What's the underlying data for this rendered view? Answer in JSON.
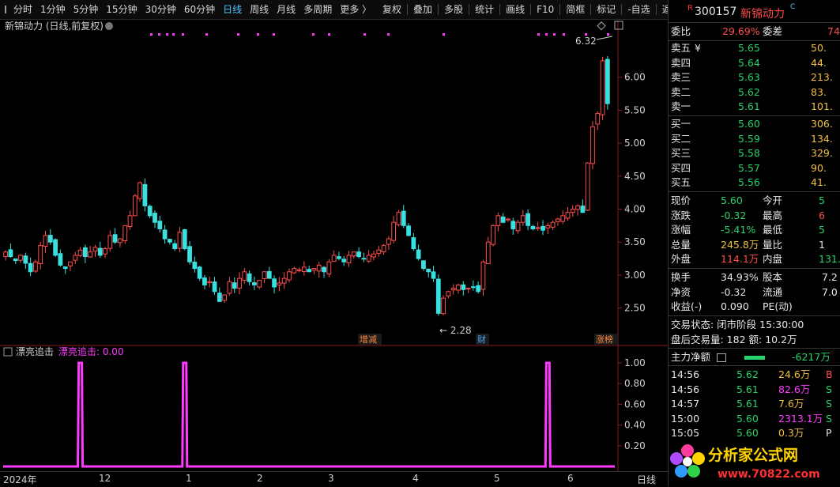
{
  "toolbar": {
    "periods": [
      "分时",
      "1分钟",
      "5分钟",
      "15分钟",
      "30分钟",
      "60分钟",
      "日线",
      "周线",
      "月线",
      "多周期",
      "更多 〉"
    ],
    "active_period": "日线",
    "actions": [
      "复权",
      "叠加",
      "多股",
      "统计",
      "画线",
      "F10",
      "简框",
      "标记",
      "-自选",
      "返回"
    ]
  },
  "chart": {
    "title": "新锦动力 (日线,前复权)",
    "indicator_name": "漂亮追击",
    "indicator_value_label": "漂亮追击: 0.00",
    "high_marker": "6.32",
    "low_marker": "2.28",
    "tags": [
      {
        "text": "增减",
        "color": "#ff8a3d"
      },
      {
        "text": "财",
        "color": "#4fa8ff"
      },
      {
        "text": "涨榜",
        "color": "#ff8a3d"
      }
    ],
    "x_labels": [
      "2024年",
      "12",
      "1",
      "2",
      "3",
      "4",
      "5",
      "6"
    ],
    "bottom_label": "日线"
  },
  "chart_data": [
    {
      "type": "candlestick",
      "price_axis": [
        "6.00",
        "5.50",
        "5.00",
        "4.50",
        "4.00",
        "3.50",
        "3.00",
        "2.50"
      ],
      "ylim": [
        2.28,
        6.32
      ],
      "closes": [
        3.35,
        3.28,
        3.22,
        3.3,
        3.18,
        3.05,
        3.2,
        3.45,
        3.6,
        3.5,
        3.3,
        3.15,
        3.1,
        3.2,
        3.3,
        3.38,
        3.28,
        3.35,
        3.42,
        3.3,
        3.4,
        3.6,
        3.5,
        3.55,
        3.75,
        3.9,
        4.2,
        4.4,
        4.05,
        3.9,
        3.8,
        3.7,
        3.55,
        3.5,
        3.4,
        3.65,
        3.4,
        3.2,
        3.1,
        2.95,
        2.85,
        2.9,
        2.75,
        2.6,
        2.7,
        2.9,
        2.8,
        2.95,
        3.05,
        2.9,
        2.85,
        2.92,
        3.05,
        2.95,
        2.82,
        2.88,
        2.95,
        3.05,
        3.1,
        3.08,
        3.12,
        3.05,
        3.1,
        3.15,
        3.05,
        3.2,
        3.3,
        3.25,
        3.2,
        3.3,
        3.35,
        3.28,
        3.25,
        3.3,
        3.32,
        3.38,
        3.45,
        3.55,
        3.8,
        3.95,
        3.75,
        3.6,
        3.4,
        3.25,
        3.1,
        3.05,
        2.95,
        2.42,
        2.65,
        2.75,
        2.8,
        2.85,
        2.78,
        2.8,
        2.82,
        2.75,
        3.2,
        3.5,
        3.75,
        3.9,
        3.8,
        3.85,
        3.7,
        3.8,
        3.9,
        3.75,
        3.7,
        3.72,
        3.68,
        3.75,
        3.8,
        3.85,
        3.9,
        3.95,
        4.0,
        4.05,
        3.95,
        4.7,
        5.25,
        5.45,
        6.25,
        5.6
      ],
      "top_markers": "magenta dots along the top of the price panel"
    },
    {
      "type": "line",
      "y_axis": [
        "1.00",
        "0.80",
        "0.60",
        "0.40",
        "0.20"
      ],
      "ylim": [
        0,
        1
      ],
      "spikes_at_bar": [
        15,
        36,
        109
      ],
      "color": "#ff3bff"
    }
  ],
  "quote": {
    "flag": "R",
    "code": "300157",
    "name": "新锦动力",
    "flag2": "C",
    "webi_label": "委比",
    "webi_value": "29.69%",
    "wecha_label": "委差",
    "wecha_value": "74",
    "sell": [
      {
        "label": "卖五",
        "mark": "¥",
        "price": "5.65",
        "vol": "50."
      },
      {
        "label": "卖四",
        "mark": "",
        "price": "5.64",
        "vol": "44."
      },
      {
        "label": "卖三",
        "mark": "",
        "price": "5.63",
        "vol": "213."
      },
      {
        "label": "卖二",
        "mark": "",
        "price": "5.62",
        "vol": "83."
      },
      {
        "label": "卖一",
        "mark": "",
        "price": "5.61",
        "vol": "101."
      }
    ],
    "buy": [
      {
        "label": "买一",
        "price": "5.60",
        "vol": "306."
      },
      {
        "label": "买二",
        "price": "5.59",
        "vol": "134."
      },
      {
        "label": "买三",
        "price": "5.58",
        "vol": "329."
      },
      {
        "label": "买四",
        "price": "5.57",
        "vol": "90."
      },
      {
        "label": "买五",
        "price": "5.56",
        "vol": "41."
      }
    ],
    "stats": [
      {
        "l1": "现价",
        "v1": "5.60",
        "c1": "green",
        "l2": "今开",
        "v2": "5",
        "c2": "green"
      },
      {
        "l1": "涨跌",
        "v1": "-0.32",
        "c1": "green",
        "l2": "最高",
        "v2": "6",
        "c2": "red"
      },
      {
        "l1": "涨幅",
        "v1": "-5.41%",
        "c1": "green",
        "l2": "最低",
        "v2": "5",
        "c2": "green"
      },
      {
        "l1": "总量",
        "v1": "245.8万",
        "c1": "yellow",
        "l2": "量比",
        "v2": "1",
        "c2": "white"
      },
      {
        "l1": "外盘",
        "v1": "114.1万",
        "c1": "red",
        "l2": "内盘",
        "v2": "131.",
        "c2": "green"
      }
    ],
    "stats2": [
      {
        "l1": "换手",
        "v1": "34.93%",
        "c1": "white",
        "l2": "股本",
        "v2": "7.2",
        "c2": "white"
      },
      {
        "l1": "净资",
        "v1": "-0.32",
        "c1": "white",
        "l2": "流通",
        "v2": "7.0",
        "c2": "white"
      },
      {
        "l1": "收益(-)",
        "v1": "0.090",
        "c1": "white",
        "l2": "PE(动)",
        "v2": "",
        "c2": "white"
      }
    ],
    "status_line": "交易状态: 闭市阶段 15:30:00",
    "after_line": "盘后交易量: 182  额: 10.2万",
    "main_force_label": "主力净额",
    "main_force_value": "-6217万",
    "ticks": [
      {
        "time": "14:56",
        "price": "5.62",
        "vol": "24.6万",
        "flag": "B",
        "vc": "yellow",
        "fc": "red"
      },
      {
        "time": "14:56",
        "price": "5.61",
        "vol": "82.6万",
        "flag": "S",
        "vc": "mag",
        "fc": "green"
      },
      {
        "time": "14:57",
        "price": "5.61",
        "vol": "7.6万",
        "flag": "S",
        "vc": "yellow",
        "fc": "green"
      },
      {
        "time": "15:00",
        "price": "5.60",
        "vol": "2313.1万",
        "flag": "S",
        "vc": "mag",
        "fc": "green"
      },
      {
        "time": "15:05",
        "price": "5.60",
        "vol": "0.3万",
        "flag": "P",
        "vc": "yellow",
        "fc": "white"
      }
    ]
  },
  "logo": {
    "text": "分析家公式网",
    "url": "www.70822.com"
  },
  "colors": {
    "up": "#ff4d4d",
    "down": "#38e0e0",
    "indicator": "#ff3bff",
    "accent": "#4fc3ff"
  }
}
